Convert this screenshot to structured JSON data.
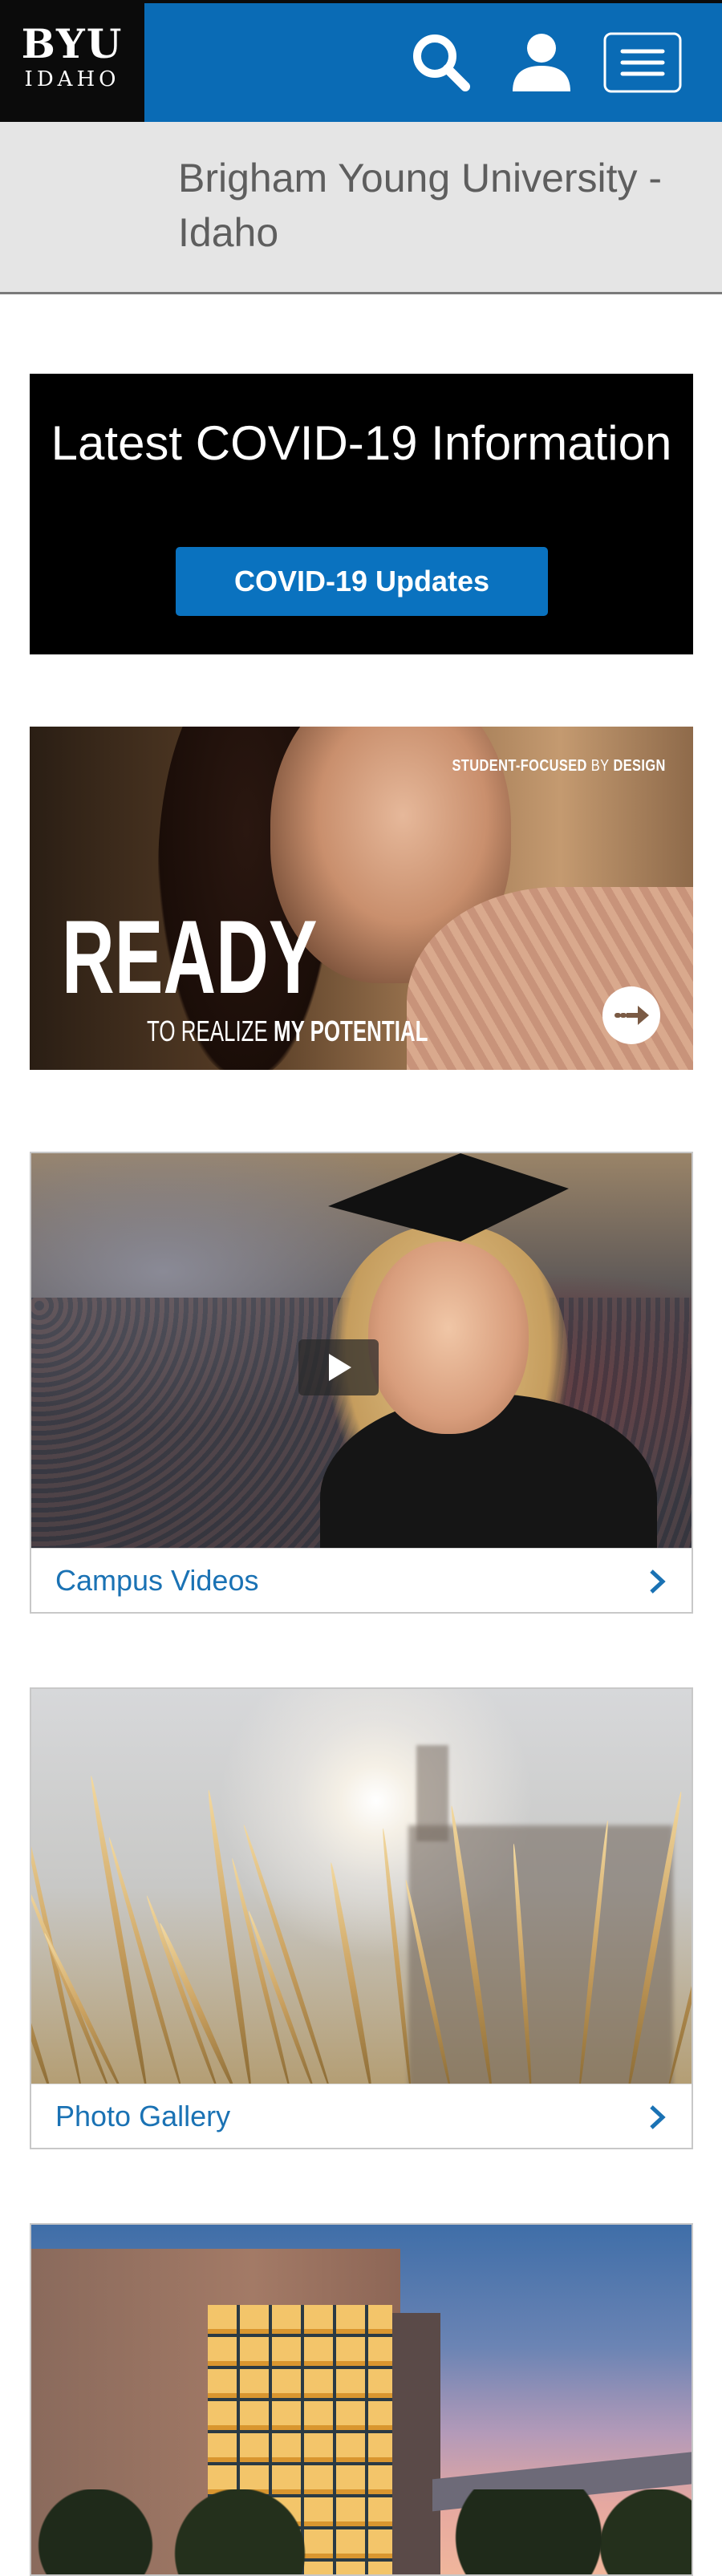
{
  "header": {
    "logo_top": "BYU",
    "logo_bottom": "IDAHO",
    "icons": [
      "search-icon",
      "user-icon",
      "menu-icon"
    ],
    "colors": {
      "bar": "#0a6bb5",
      "logo_bg": "#0b0b0b"
    }
  },
  "site": {
    "title": "Brigham Young University - Idaho"
  },
  "covid": {
    "heading": "Latest COVID-19 Information",
    "button_label": "COVID-19 Updates",
    "colors": {
      "bg": "#000000",
      "button": "#0a72bf"
    }
  },
  "promo": {
    "tag_bold_1": "STUDENT-FOCUSED",
    "tag_light": "BY",
    "tag_bold_2": "DESIGN",
    "headline": "READY",
    "sub_prefix": "TO REALIZE",
    "sub_bold": "MY POTENTIAL",
    "arrow_icon": "arrow-right-circle-icon"
  },
  "cards": [
    {
      "label": "Campus Videos",
      "icon": "chevron-right-icon",
      "overlay_icon": "play-icon"
    },
    {
      "label": "Photo Gallery",
      "icon": "chevron-right-icon"
    }
  ]
}
